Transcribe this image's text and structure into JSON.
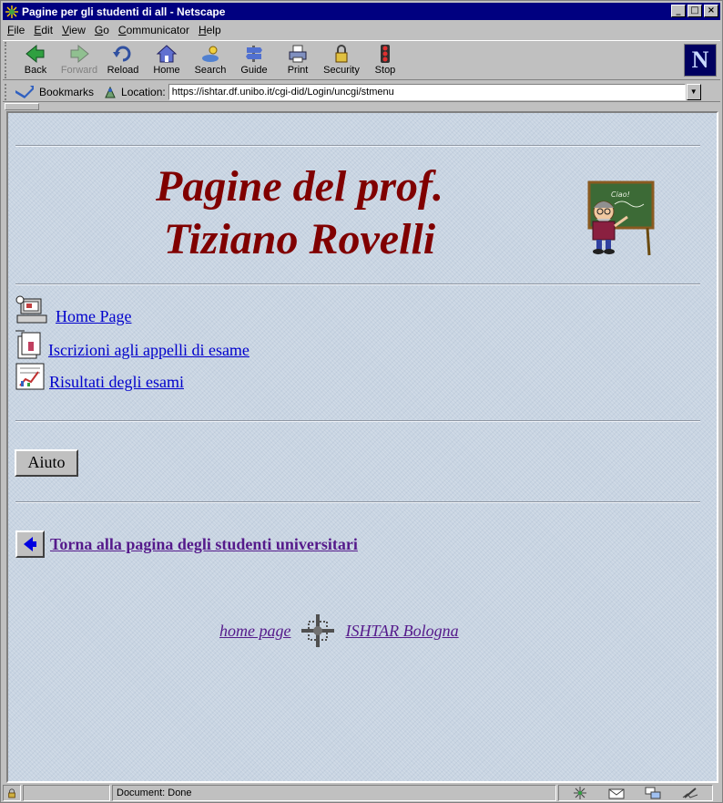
{
  "window": {
    "title": "Pagine per gli studenti di all - Netscape"
  },
  "menu": [
    {
      "key": "F",
      "rest": "ile"
    },
    {
      "key": "E",
      "rest": "dit"
    },
    {
      "key": "V",
      "rest": "iew"
    },
    {
      "key": "G",
      "rest": "o"
    },
    {
      "key": "C",
      "rest": "ommunicator"
    },
    {
      "key": "H",
      "rest": "elp"
    }
  ],
  "toolbar": {
    "back": "Back",
    "forward": "Forward",
    "reload": "Reload",
    "home": "Home",
    "search": "Search",
    "guide": "Guide",
    "print": "Print",
    "security": "Security",
    "stop": "Stop",
    "logo": "N"
  },
  "location": {
    "bookmarks_label": "Bookmarks",
    "location_label": "Location:",
    "url": "https://ishtar.df.unibo.it/cgi-did/Login/uncgi/stmenu"
  },
  "page": {
    "heading_line1": "Pagine del prof.",
    "heading_line2": "Tiziano Rovelli",
    "blackboard_text": "Ciao!",
    "nav": {
      "home": "Home Page",
      "iscrizioni": "Iscrizioni agli appelli di esame",
      "risultati": "Risultati degli esami"
    },
    "aiuto": "Aiuto",
    "back_link": "Torna alla pagina degli studenti universitari",
    "footer": {
      "home": "home page",
      "ishtar": "ISHTAR Bologna"
    }
  },
  "status": {
    "text": "Document: Done"
  },
  "colors": {
    "heading": "#800000",
    "link": "#0000cc",
    "visited": "#551a8b",
    "titlebar": "#000080"
  }
}
